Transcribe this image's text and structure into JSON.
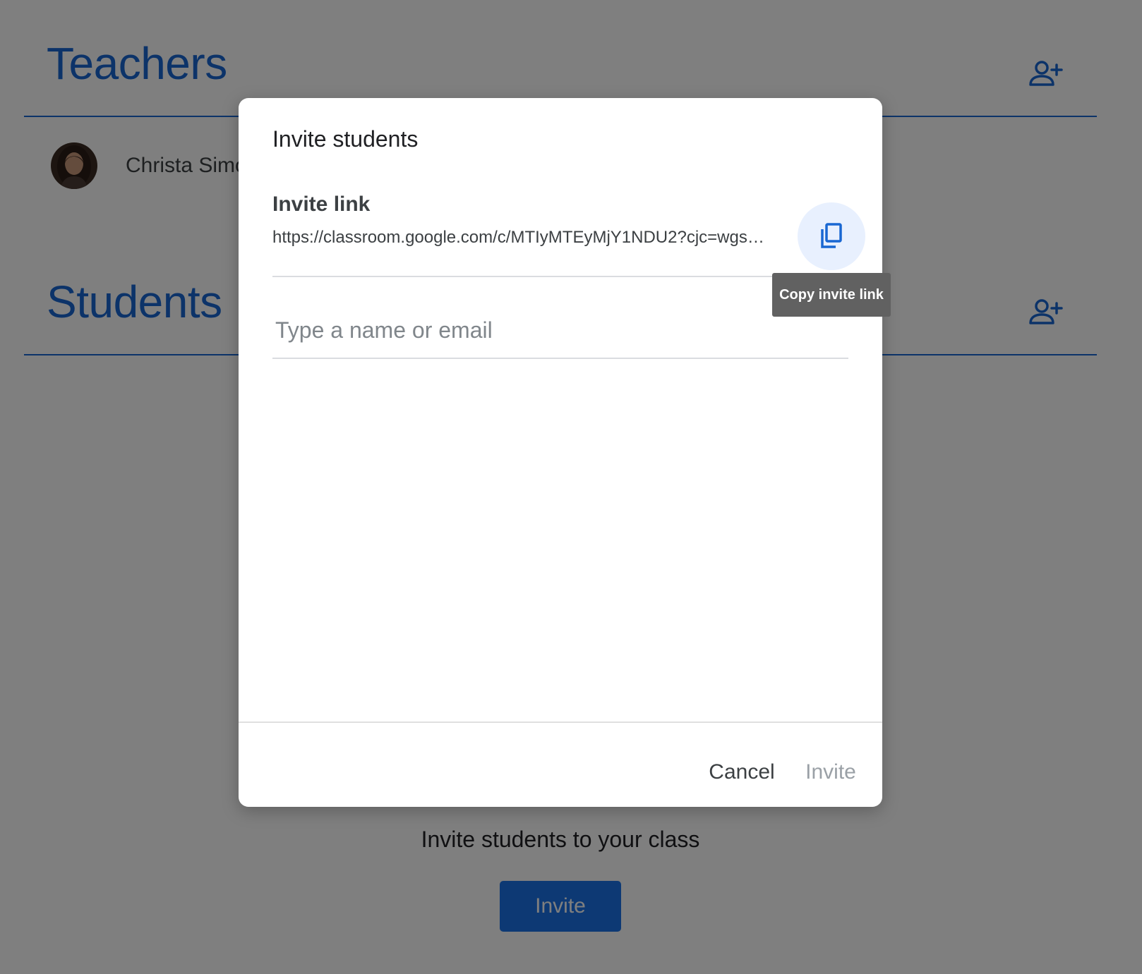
{
  "page": {
    "teachers_title": "Teachers",
    "students_title": "Students",
    "teacher_name": "Christa Simo",
    "empty_text": "Invite students to your class",
    "invite_button_label": "Invite",
    "accent_color": "#1967d2"
  },
  "dialog": {
    "title": "Invite students",
    "link_heading": "Invite link",
    "link_url": "https://classroom.google.com/c/MTIyMTEyMjY1NDU2?cjc=wgs…",
    "copy_tooltip": "Copy invite link",
    "input_placeholder": "Type a name or email",
    "input_value": "",
    "cancel_label": "Cancel",
    "invite_label": "Invite",
    "invite_disabled": true
  },
  "icons": {
    "add_teacher": "person-add-icon",
    "add_student": "person-add-icon",
    "copy": "content-copy-icon",
    "avatar": "teacher-avatar"
  }
}
